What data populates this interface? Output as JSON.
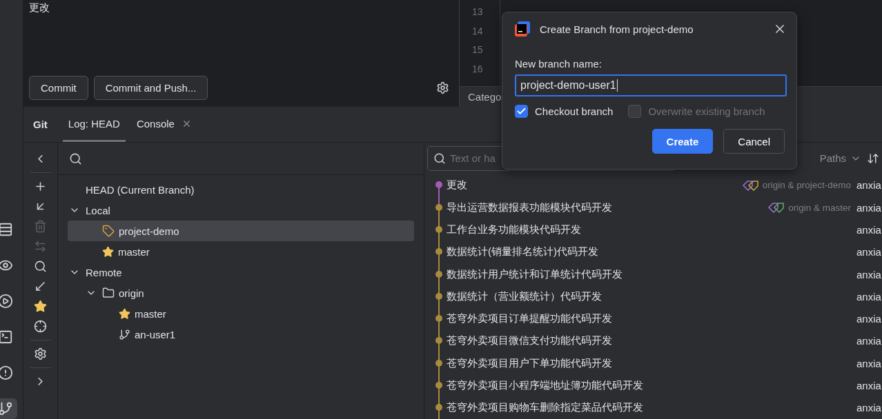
{
  "commit_panel": {
    "message": "更改",
    "buttons": [
      "Commit",
      "Commit and Push..."
    ]
  },
  "editor": {
    "line_numbers": [
      "13",
      "14",
      "15",
      "16"
    ],
    "tab_label": "Catego"
  },
  "tool_window": {
    "title": "Git",
    "tabs": [
      {
        "label": "Log: HEAD",
        "selected": true,
        "closable": false
      },
      {
        "label": "Console",
        "selected": false,
        "closable": true
      }
    ]
  },
  "side_stripe": [
    {
      "kind": "structure",
      "selected": false
    },
    {
      "kind": "watch",
      "selected": false
    },
    {
      "kind": "run",
      "selected": false
    },
    {
      "kind": "terminal",
      "selected": false
    },
    {
      "kind": "problems",
      "selected": false
    },
    {
      "kind": "git",
      "selected": true
    }
  ],
  "branch_toolbar": [
    {
      "kind": "collapse",
      "disabled": false
    },
    {
      "kind": "add",
      "disabled": false
    },
    {
      "kind": "update",
      "disabled": false
    },
    {
      "kind": "delete",
      "disabled": true
    },
    {
      "kind": "compare",
      "disabled": true
    },
    {
      "kind": "search",
      "disabled": false
    },
    {
      "kind": "fetch",
      "disabled": false
    },
    {
      "kind": "favorite",
      "disabled": false
    },
    {
      "kind": "locate",
      "disabled": false
    },
    {
      "kind": "settings",
      "disabled": false
    },
    {
      "kind": "expand",
      "disabled": false
    }
  ],
  "branches": [
    {
      "label": "HEAD (Current Branch)",
      "selected": false
    },
    {
      "label": "Local",
      "expanded": true,
      "selected": false,
      "children": [
        {
          "label": "project-demo",
          "kind": "tag",
          "selected": true
        },
        {
          "label": "master",
          "kind": "favorite",
          "selected": false
        }
      ]
    },
    {
      "label": "Remote",
      "expanded": true,
      "selected": false,
      "children": [
        {
          "label": "origin",
          "kind": "folder",
          "expanded": true,
          "selected": false,
          "children": [
            {
              "label": "master",
              "kind": "favorite",
              "selected": false
            },
            {
              "label": "an-user1",
              "kind": "branch",
              "selected": false
            }
          ]
        }
      ]
    }
  ],
  "log": {
    "search_placeholder": "Text or ha",
    "paths_label": "Paths",
    "commits": [
      {
        "message": "更改",
        "refs": "origin & project-demo",
        "tags": [
          {
            "color": "#9b6fd6"
          },
          {
            "color": "#c9a43f"
          }
        ],
        "author": "anxia",
        "color": "#a45ab8"
      },
      {
        "message": "导出运营数据报表功能模块代码开发",
        "refs": "origin & master",
        "tags": [
          {
            "color": "#9b6fd6"
          },
          {
            "color": "#5fa865"
          }
        ],
        "author": "anxia",
        "color": "#a98a3e"
      },
      {
        "message": "工作台业务功能模块代码开发",
        "author": "anxia",
        "color": "#a98a3e"
      },
      {
        "message": "数据统计(销量排名统计)代码开发",
        "author": "anxia",
        "color": "#a98a3e"
      },
      {
        "message": "数据统计用户统计和订单统计代码开发",
        "author": "anxia",
        "color": "#a98a3e"
      },
      {
        "message": "数据统计（营业额统计）代码开发",
        "author": "anxia",
        "color": "#a98a3e"
      },
      {
        "message": "苍穹外卖项目订单提醒功能代码开发",
        "author": "anxia",
        "color": "#a98a3e"
      },
      {
        "message": "苍穹外卖项目微信支付功能代码开发",
        "author": "anxia",
        "color": "#a98a3e"
      },
      {
        "message": "苍穹外卖项目用户下单功能代码开发",
        "author": "anxia",
        "color": "#a98a3e"
      },
      {
        "message": "苍穹外卖项目小程序端地址簿功能代码开发",
        "author": "anxia",
        "color": "#a98a3e"
      },
      {
        "message": "苍穹外卖项目购物车删除指定菜品代码开发",
        "author": "anxia",
        "color": "#a98a3e"
      }
    ]
  },
  "dialog": {
    "title": "Create Branch from project-demo",
    "field_label": "New branch name:",
    "value": "project-demo-user1",
    "options": [
      {
        "label": "Checkout branch",
        "checked": true,
        "disabled": false
      },
      {
        "label": "Overwrite existing branch",
        "checked": false,
        "disabled": true
      }
    ],
    "buttons": [
      {
        "label": "Create",
        "primary": true
      },
      {
        "label": "Cancel",
        "primary": false
      }
    ]
  }
}
